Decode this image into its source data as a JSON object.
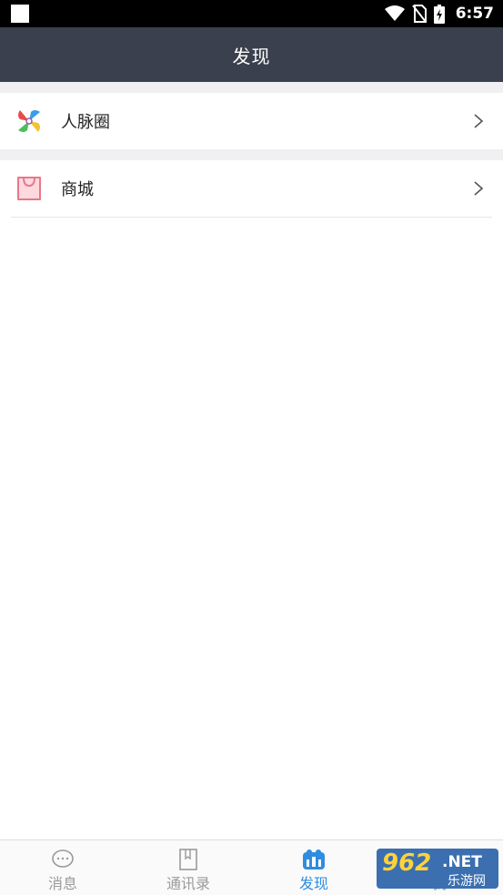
{
  "status_bar": {
    "time": "6:57",
    "icons": [
      "wifi-icon",
      "no-sim-icon",
      "battery-icon"
    ]
  },
  "header": {
    "title": "发现"
  },
  "list": {
    "items": [
      {
        "label": "人脉圈",
        "icon": "pinwheel-icon"
      },
      {
        "label": "商城",
        "icon": "shopping-bag-icon"
      }
    ]
  },
  "tabbar": {
    "tabs": [
      {
        "label": "消息",
        "icon": "chat-bubble-icon",
        "active": false
      },
      {
        "label": "通讯录",
        "icon": "address-book-icon",
        "active": false
      },
      {
        "label": "发现",
        "icon": "discover-icon",
        "active": true
      },
      {
        "label": "我",
        "icon": "profile-icon",
        "active": false
      }
    ],
    "active_color": "#2e8de0",
    "inactive_color": "#9a9a9a"
  },
  "watermark": {
    "number": "962",
    "net": ".NET",
    "sub": "乐游网"
  },
  "colors": {
    "header_bg": "#3a404d",
    "status_bg": "#000000"
  }
}
